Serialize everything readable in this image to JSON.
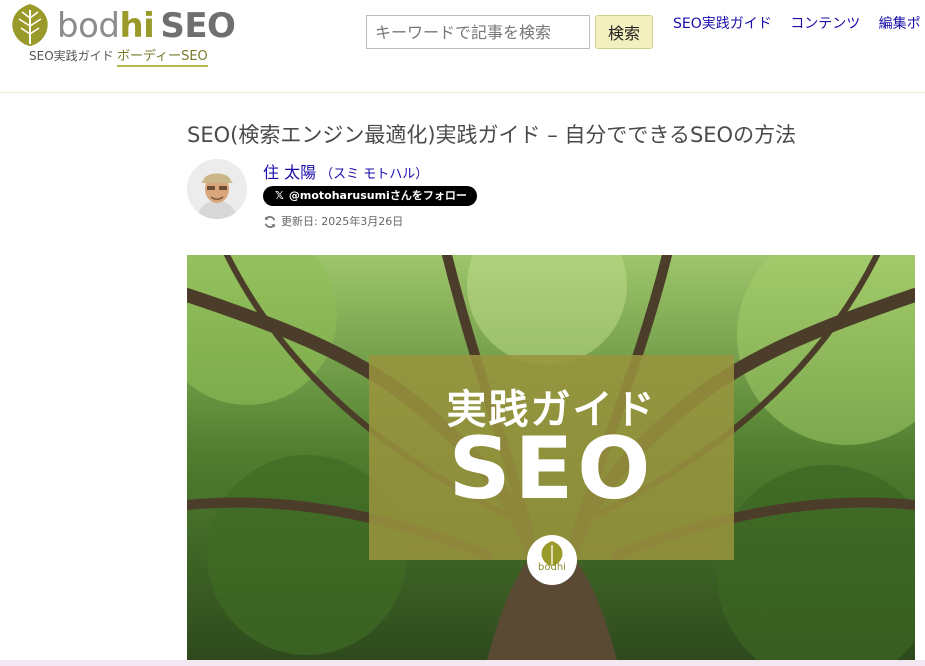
{
  "site": {
    "logo_word1": "bod",
    "logo_word2": "hi",
    "logo_word3": "SEO",
    "tagline": "SEO実践ガイド",
    "sub_brand": "ボーディーSEO"
  },
  "search": {
    "placeholder": "キーワードで記事を検索",
    "button_label": "検索"
  },
  "nav": {
    "items": [
      "SEO実践ガイド",
      "コンテンツ",
      "編集ポ"
    ]
  },
  "article": {
    "title": "SEO(検索エンジン最適化)実践ガイド – 自分でできるSEOの方法",
    "author_name": "住 太陽",
    "author_kana": "（スミ モトハル）",
    "follow_label": "@motoharusumiさんをフォロー",
    "updated": "更新日: 2025年3月26日"
  },
  "hero": {
    "line1": "実践ガイド",
    "line2": "SEO",
    "badge_text": "bodhi"
  },
  "colors": {
    "brand": "#9a9a2a",
    "link": "#1a0dab",
    "button_bg": "#f3f0bf"
  },
  "icons": [
    "bodhi-leaf-icon",
    "x-icon",
    "refresh-icon"
  ]
}
